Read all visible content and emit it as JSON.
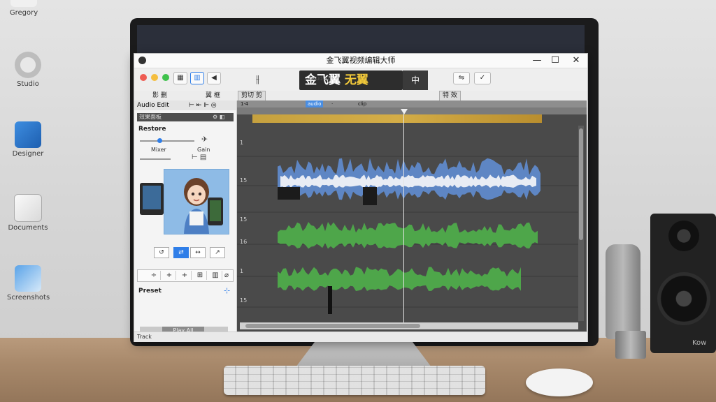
{
  "desktop": {
    "icons": [
      {
        "label": "Gregory"
      },
      {
        "label": "Studio"
      },
      {
        "label": "Designer"
      },
      {
        "label": "Documents"
      },
      {
        "label": "Screenshots"
      }
    ]
  },
  "speaker": {
    "label": "Kow"
  },
  "window": {
    "title": "金飞翼视频编辑大师",
    "controls": {
      "minimize": "—",
      "maximize": "☐",
      "close": "✕"
    }
  },
  "toolbar": {
    "brand_main": "金飞翼",
    "brand_accent": "无翼",
    "brand_sub": "Loud all",
    "brand_button": "中"
  },
  "menu": {
    "items": [
      "影  删",
      "翼  框"
    ],
    "chips": [
      "剪切  剪",
      "特  效"
    ]
  },
  "left_panel": {
    "header": "Audio Edit",
    "subheader": "效果面板",
    "section1": "Restore",
    "slider1_label": "Mixer",
    "slider1_value": 0.36,
    "slider1_right": "Gain",
    "slider2_value": 0.55,
    "section2": "Preset",
    "footer_button": "Play All",
    "buttons": [
      "↺",
      "⇄",
      "↔",
      "↗"
    ],
    "tools": [
      "÷",
      "+",
      "+",
      "⊞",
      "▥",
      "⌀"
    ]
  },
  "timeline": {
    "tabs": [
      "1·4",
      "audio",
      "·",
      "clip"
    ],
    "tracks": [
      "1",
      "15",
      "15",
      "16",
      "1",
      "15"
    ]
  },
  "statusbar": {
    "text": "Track"
  },
  "colors": {
    "audio_blue": "#5e86c4",
    "audio_green": "#4ea64a",
    "accent": "#2f7ee8",
    "gold": "#d4ad47"
  }
}
